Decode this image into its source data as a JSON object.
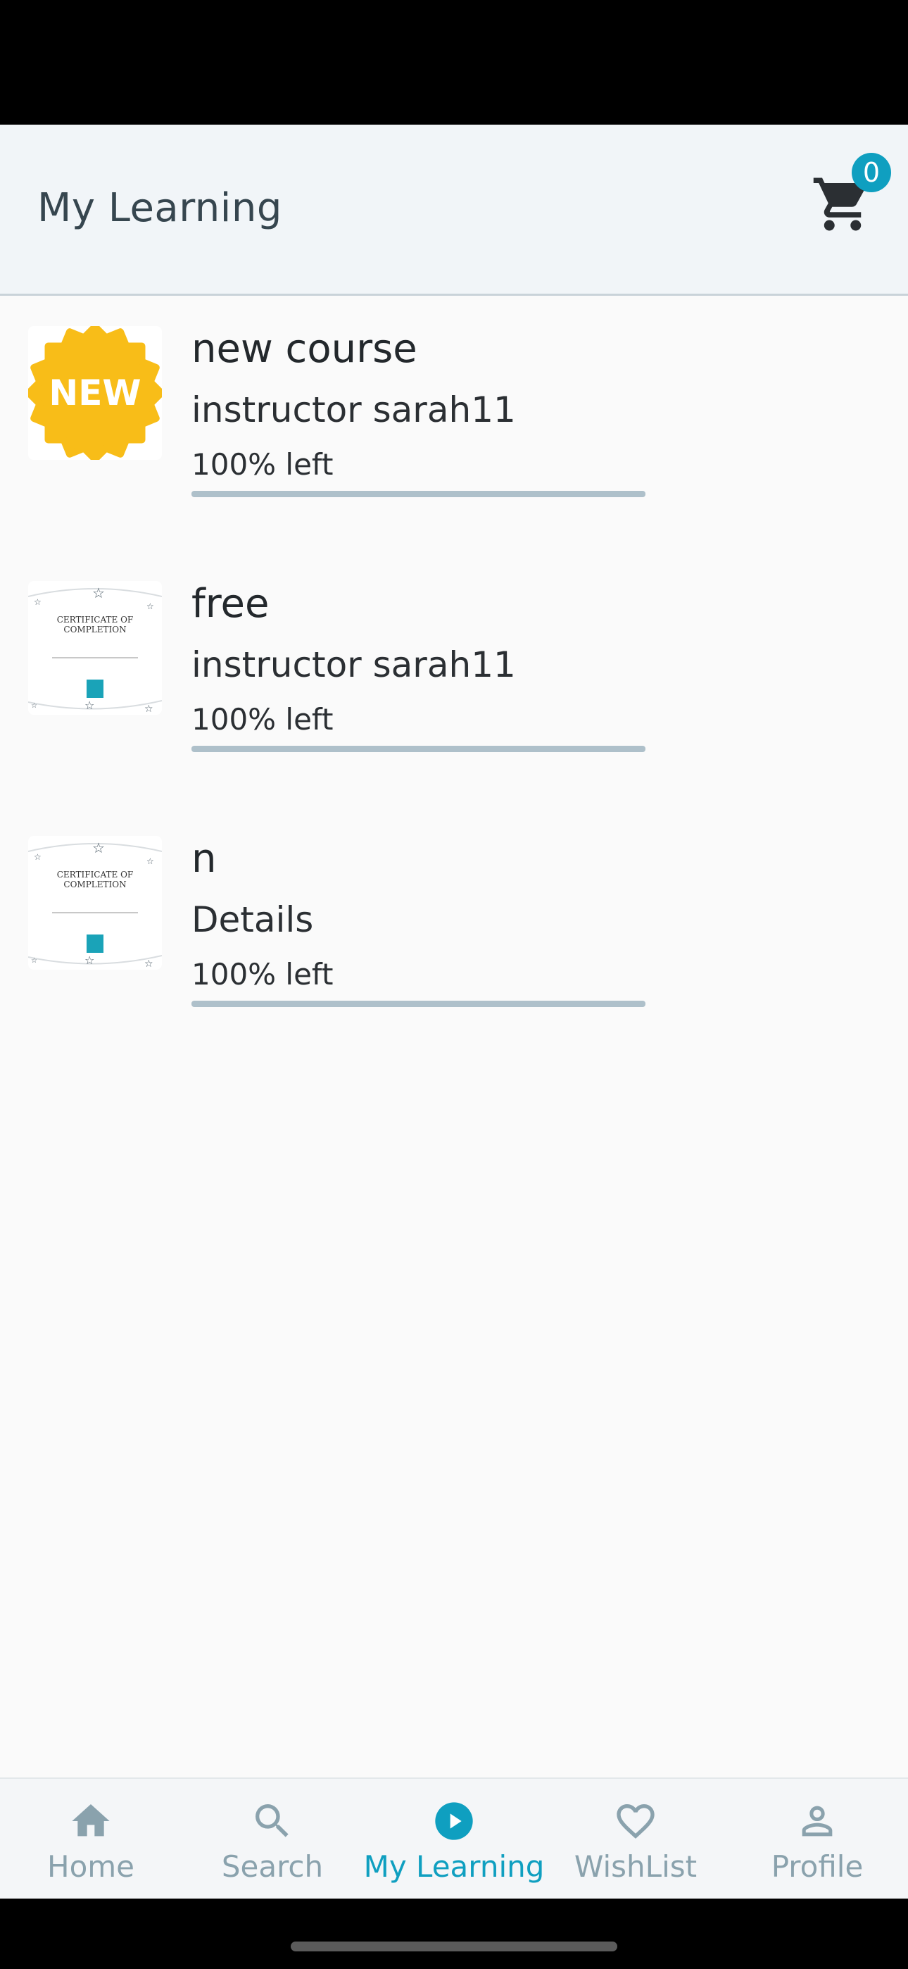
{
  "header": {
    "title": "My Learning",
    "cart_count": "0"
  },
  "courses": [
    {
      "title": "new course",
      "subtitle": "instructor sarah11",
      "progress_label": "100% left",
      "progress_remaining": 1.0,
      "thumbnail": "new-badge-icon",
      "thumbnail_text": "NEW"
    },
    {
      "title": "free",
      "subtitle": "instructor sarah11",
      "progress_label": "100% left",
      "progress_remaining": 1.0,
      "thumbnail": "certificate-image",
      "thumbnail_text": "CERTIFICATE OF COMPLETION"
    },
    {
      "title": "n",
      "subtitle": "Details",
      "progress_label": "100% left",
      "progress_remaining": 1.0,
      "thumbnail": "certificate-image",
      "thumbnail_text": "CERTIFICATE OF COMPLETION"
    }
  ],
  "nav": {
    "items": [
      {
        "label": "Home",
        "icon": "home-icon"
      },
      {
        "label": "Search",
        "icon": "search-icon"
      },
      {
        "label": "My Learning",
        "icon": "play-circle-icon",
        "active": true
      },
      {
        "label": "WishList",
        "icon": "heart-icon"
      },
      {
        "label": "Profile",
        "icon": "person-icon"
      }
    ]
  },
  "colors": {
    "accent": "#0f9fc0",
    "new_badge": "#f8bd18",
    "inactive_nav": "#8aa2ad",
    "progress": "#aec0ca"
  }
}
